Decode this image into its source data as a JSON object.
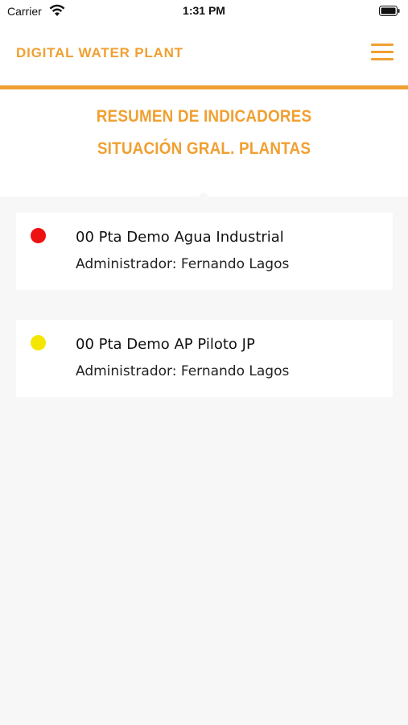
{
  "status_bar": {
    "carrier": "Carrier",
    "time": "1:31 PM",
    "wifi_icon": "wifi-icon",
    "battery_icon": "battery-full-icon"
  },
  "header": {
    "title": "DIGITAL WATER PLANT",
    "menu_icon": "hamburger-menu-icon",
    "accent_color": "#f0a032"
  },
  "summary": {
    "line1": "RESUMEN DE INDICADORES",
    "line2": "SITUACIÓN GRAL. PLANTAS"
  },
  "plants": [
    {
      "name": "00 Pta Demo Agua Industrial",
      "admin": "Administrador: Fernando Lagos",
      "status_color": "#ee1111"
    },
    {
      "name": "00 Pta Demo AP Piloto JP",
      "admin": "Administrador: Fernando Lagos",
      "status_color": "#f5e600"
    }
  ]
}
